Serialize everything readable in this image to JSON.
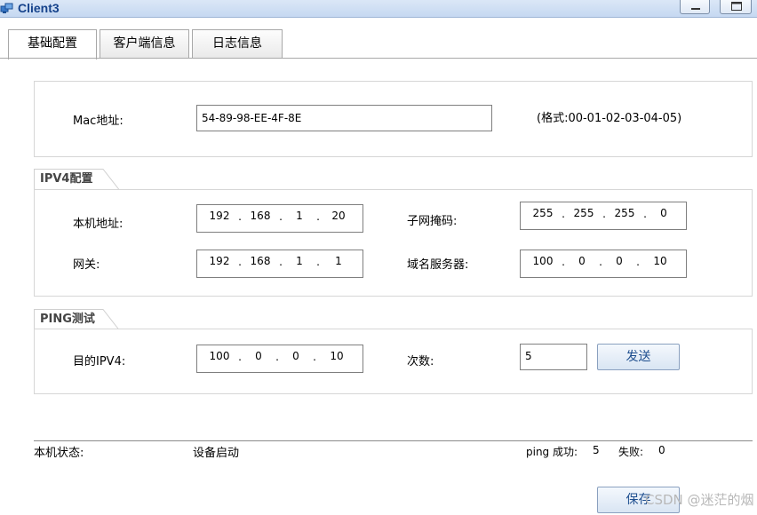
{
  "window": {
    "title": "Client3"
  },
  "tabs": [
    {
      "label": "基础配置",
      "active": true
    },
    {
      "label": "客户端信息",
      "active": false
    },
    {
      "label": "日志信息",
      "active": false
    }
  ],
  "mac": {
    "label": "Mac地址:",
    "value": "54-89-98-EE-4F-8E",
    "hint": "(格式:00-01-02-03-04-05)"
  },
  "ipv4": {
    "group_title": "IPV4配置",
    "local_label": "本机地址:",
    "local_ip": [
      "192",
      "168",
      "1",
      "20"
    ],
    "mask_label": "子网掩码:",
    "mask": [
      "255",
      "255",
      "255",
      "0"
    ],
    "gateway_label": "网关:",
    "gateway": [
      "192",
      "168",
      "1",
      "1"
    ],
    "dns_label": "域名服务器:",
    "dns": [
      "100",
      "0",
      "0",
      "10"
    ]
  },
  "ping": {
    "group_title": "PING测试",
    "target_label": "目的IPV4:",
    "target": [
      "100",
      "0",
      "0",
      "10"
    ],
    "count_label": "次数:",
    "count": "5",
    "send_label": "发送"
  },
  "status": {
    "label": "本机状态:",
    "value": "设备启动",
    "success_label": "ping 成功:",
    "success_count": "5",
    "fail_label": "失败:",
    "fail_count": "0"
  },
  "save_label": "保存",
  "watermark": "CSDN @迷茫的烟",
  "colors": {
    "title_text": "#15428b",
    "button_text": "#1f4f8f"
  }
}
